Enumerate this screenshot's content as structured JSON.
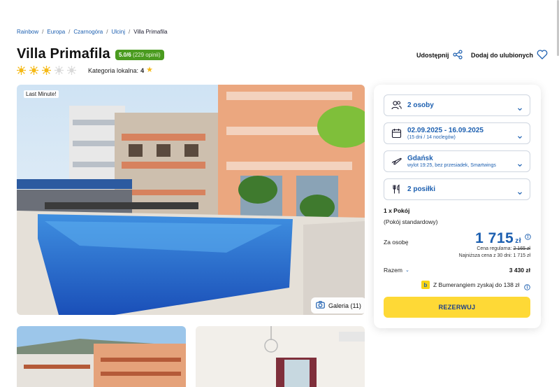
{
  "breadcrumb": {
    "items": [
      "Rainbow",
      "Europa",
      "Czarnogóra",
      "Ulcinj"
    ],
    "current": "Villa Primafila",
    "separator": "/"
  },
  "hotel": {
    "name": "Villa Primafila",
    "rating_score": "5.0/6",
    "rating_opinions": "(229 opinii)",
    "suns_filled": 3,
    "suns_total": 5,
    "local_category_label": "Kategoria lokalna:",
    "local_category_value": "4"
  },
  "actions": {
    "share_label": "Udostępnij",
    "favorite_label": "Dodaj do ulubionych"
  },
  "gallery": {
    "badge": "Last Minute!",
    "button_label": "Galeria (11)"
  },
  "booking": {
    "persons": "2 osoby",
    "dates": "02.09.2025 - 16.09.2025",
    "dates_sub": "(15 dni / 14 noclegów)",
    "departure": "Gdańsk",
    "departure_sub": "wylot 19:25, bez przesiadek, Smartwings",
    "meals": "2 posiłki",
    "room_title": "1 x Pokój",
    "room_type": "(Pokój standardowy)",
    "per_person_label": "Za osobę",
    "price": "1 715",
    "currency": "zł",
    "regular_price_label": "Cena regularna:",
    "regular_price": "2 165 zł",
    "lowest_price_text": "Najniższa cena z 30 dni: 1 715 zł",
    "total_label": "Razem",
    "total_value": "3 430 zł",
    "bumerang_text": "Z Bumerangiem zyskaj do 138 zł",
    "reserve_label": "REZERWUJ"
  },
  "colors": {
    "brand_blue": "#1c5fb0",
    "rating_green": "#4a9b1f",
    "cta_yellow": "#fed936",
    "sun_yellow": "#f5b915"
  }
}
